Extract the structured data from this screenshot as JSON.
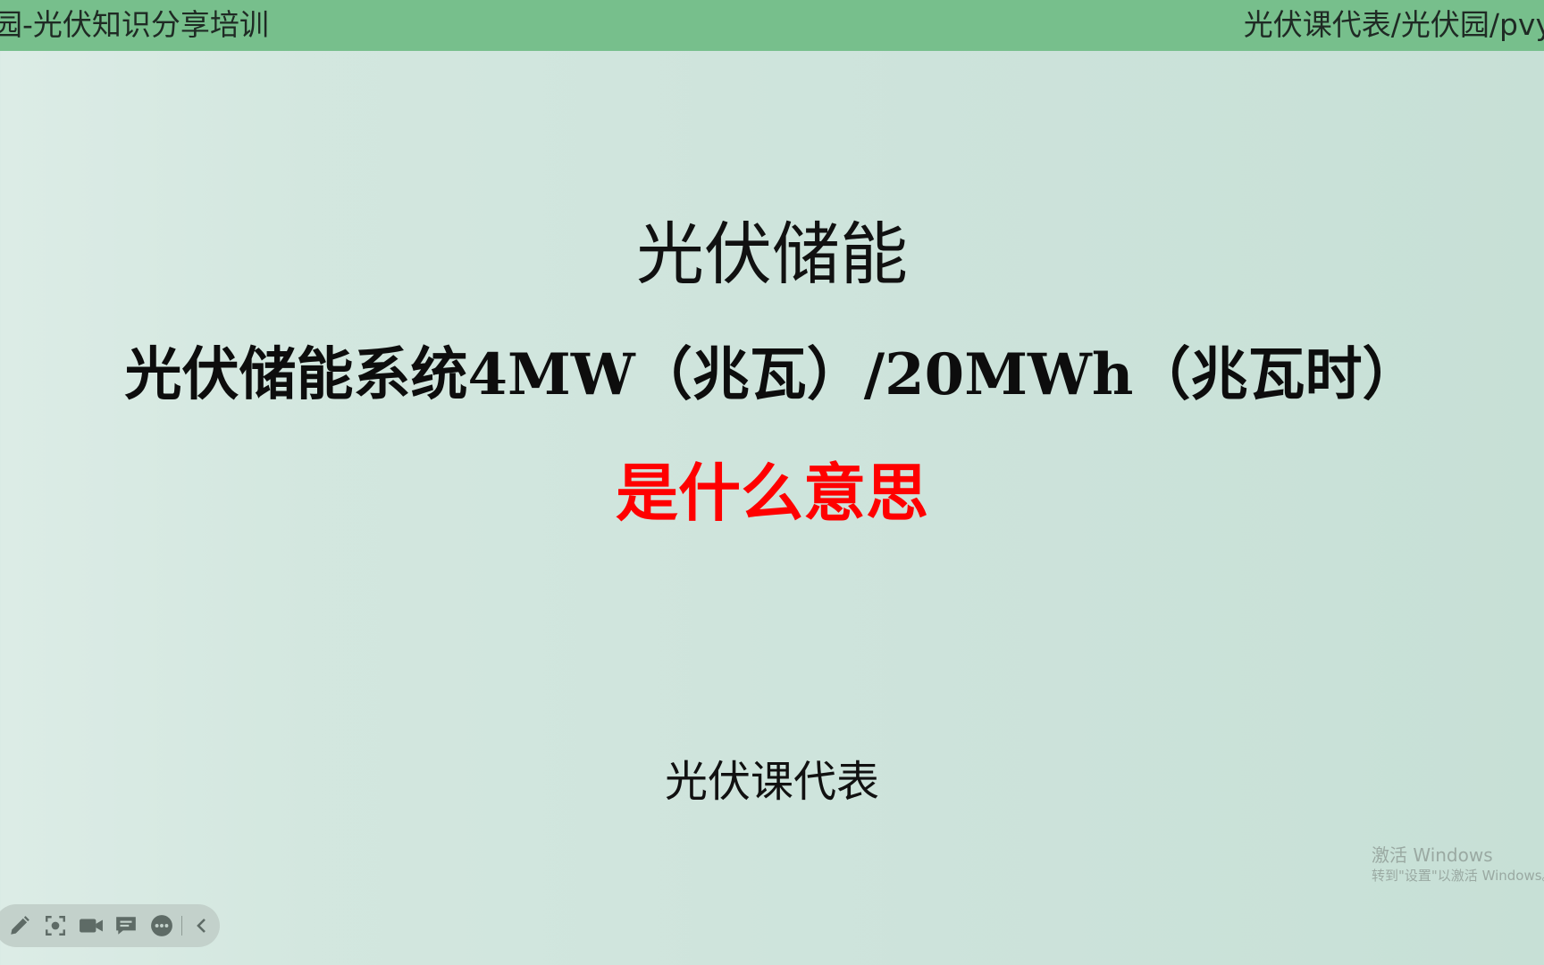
{
  "header": {
    "left_text": "园-光伏知识分享培训",
    "right_text": "光伏课代表/光伏园/pvy"
  },
  "slide": {
    "title": "光伏储能",
    "subtitle": "光伏储能系统4MW（兆瓦）/20MWh（兆瓦时）",
    "question": "是什么意思",
    "author": "光伏课代表"
  },
  "colors": {
    "header_bar": "#77bf8c",
    "question_text": "#ff0000"
  },
  "watermark": {
    "title": "激活 Windows",
    "subtitle": "转到\"设置\"以激活 Windows。"
  },
  "toolbar": {
    "icons": [
      "pen-icon",
      "screenshot-icon",
      "video-camera-icon",
      "comment-icon",
      "more-icon",
      "chevron-left-icon"
    ]
  }
}
